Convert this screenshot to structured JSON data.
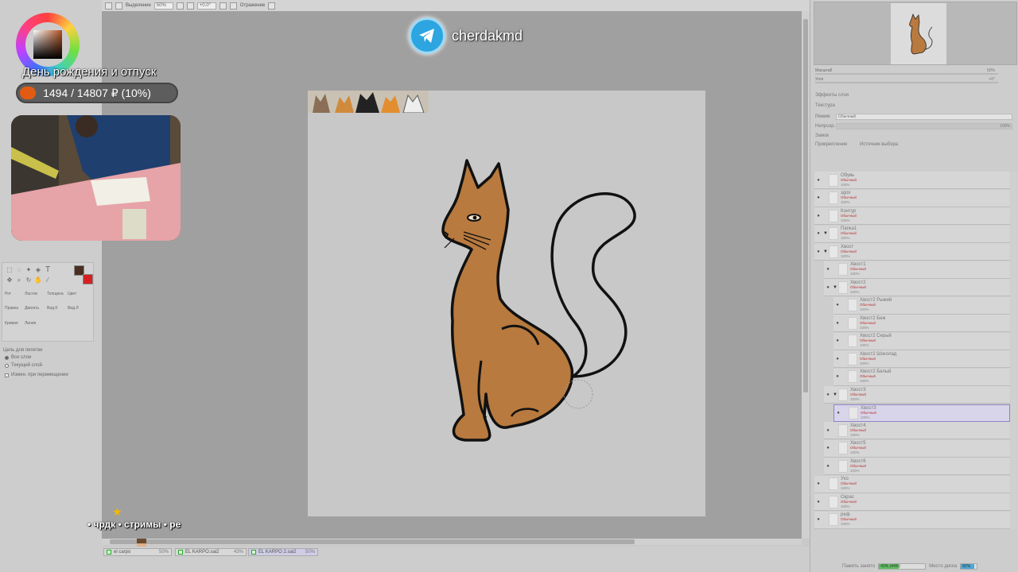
{
  "toolbar": {
    "selection_label": "Выделение",
    "zoom_value": "50%",
    "rotation_value": "+0.0°",
    "flip_label": "Отражение"
  },
  "overlay": {
    "donation_title": "День рождения и отпуск",
    "donation_text": "1494 / 14807 ₽ (10%)",
    "donation_progress": 0.1,
    "telegram_handle": "cherdakmd",
    "ticker_text": "• чрдк • стримы • ре"
  },
  "left_panel": {
    "tools": {
      "row1": [
        "Рот",
        "Ластик",
        "Толщина",
        "Цвет"
      ],
      "row2": [
        "Правка",
        "Двигать",
        "Вид.К",
        "Вид.Л"
      ],
      "row3": [
        "Кривая",
        "Линия"
      ]
    },
    "source_title": "Цель для пипетки",
    "source_all": "Все слои",
    "source_current": "Текущий слой",
    "edit_note": "Измен. при перемещении",
    "primary_color": "#4a2e22",
    "secondary_color": "#d42020"
  },
  "right_panel": {
    "zoom_label": "Масштаб",
    "zoom_value": "50%",
    "angle_label": "Угол",
    "angle_value": "+0°",
    "layer_effects": "Эффекты слоя",
    "texture": "Текстура",
    "mode_label": "Режим",
    "mode_value": "Обычный",
    "opacity_label": "Непрозр.",
    "opacity_value": "100%",
    "lock_label": "Замок",
    "clip_label": "Прикрепление",
    "select_source_label": "Источник выбора",
    "layers": [
      {
        "name": "Обувь",
        "mode": "Обычный",
        "opacity": "100%",
        "indent": 0,
        "folder": false,
        "selected": false
      },
      {
        "name": "здох",
        "mode": "Обычный",
        "opacity": "100%",
        "indent": 0,
        "folder": false,
        "selected": false
      },
      {
        "name": "Контур",
        "mode": "Обычный",
        "opacity": "100%",
        "indent": 0,
        "folder": false,
        "selected": false
      },
      {
        "name": "Папка1",
        "mode": "Обычный",
        "opacity": "100%",
        "indent": 0,
        "folder": true,
        "selected": false
      },
      {
        "name": "Хвост",
        "mode": "Обычный",
        "opacity": "100%",
        "indent": 0,
        "folder": true,
        "selected": false
      },
      {
        "name": "Хвост1",
        "mode": "Обычный",
        "opacity": "100%",
        "indent": 1,
        "folder": false,
        "selected": false
      },
      {
        "name": "Хвост2",
        "mode": "Обычный",
        "opacity": "100%",
        "indent": 1,
        "folder": true,
        "selected": false
      },
      {
        "name": "Хвост2 Рыжий",
        "mode": "Обычный",
        "opacity": "100%",
        "indent": 2,
        "folder": false,
        "selected": false
      },
      {
        "name": "Хвост2 Беж",
        "mode": "Обычный",
        "opacity": "100%",
        "indent": 2,
        "folder": false,
        "selected": false
      },
      {
        "name": "Хвост2 Серый",
        "mode": "Обычный",
        "opacity": "100%",
        "indent": 2,
        "folder": false,
        "selected": false
      },
      {
        "name": "Хвост2 Шоколад",
        "mode": "Обычный",
        "opacity": "100%",
        "indent": 2,
        "folder": false,
        "selected": false
      },
      {
        "name": "Хвост2 Белый",
        "mode": "Обычный",
        "opacity": "100%",
        "indent": 2,
        "folder": false,
        "selected": false
      },
      {
        "name": "Хвост3",
        "mode": "Обычный",
        "opacity": "100%",
        "indent": 1,
        "folder": true,
        "selected": false
      },
      {
        "name": "Хвост3",
        "mode": "Обычный",
        "opacity": "100%",
        "indent": 2,
        "folder": false,
        "selected": true
      },
      {
        "name": "Хвост4",
        "mode": "Обычный",
        "opacity": "100%",
        "indent": 1,
        "folder": false,
        "selected": false
      },
      {
        "name": "Хвост5",
        "mode": "Обычный",
        "opacity": "100%",
        "indent": 1,
        "folder": false,
        "selected": false
      },
      {
        "name": "Хвост6",
        "mode": "Обычный",
        "opacity": "100%",
        "indent": 1,
        "folder": false,
        "selected": false
      },
      {
        "name": "Ухо",
        "mode": "Обычный",
        "opacity": "100%",
        "indent": 0,
        "folder": false,
        "selected": false
      },
      {
        "name": "Окрас",
        "mode": "Обычный",
        "opacity": "100%",
        "indent": 0,
        "folder": false,
        "selected": false
      },
      {
        "name": "реф",
        "mode": "Обычный",
        "opacity": "100%",
        "indent": 0,
        "folder": false,
        "selected": false
      }
    ],
    "memory_label": "Память занято",
    "memory_value": "43% (44%)",
    "disk_label": "Место диска",
    "disk_value": "82%"
  },
  "file_tabs": [
    {
      "name": "el carpo",
      "zoom": "50%",
      "active": false
    },
    {
      "name": "EL KARPO.sai2",
      "zoom": "43%",
      "active": false
    },
    {
      "name": "EL KARPO 2.sai2",
      "zoom": "50%",
      "active": true
    }
  ],
  "colors": {
    "cat_fill": "#b87a3e",
    "outline": "#111111",
    "accent_orange": "#e35b12",
    "telegram_blue": "#2ca5e0"
  }
}
